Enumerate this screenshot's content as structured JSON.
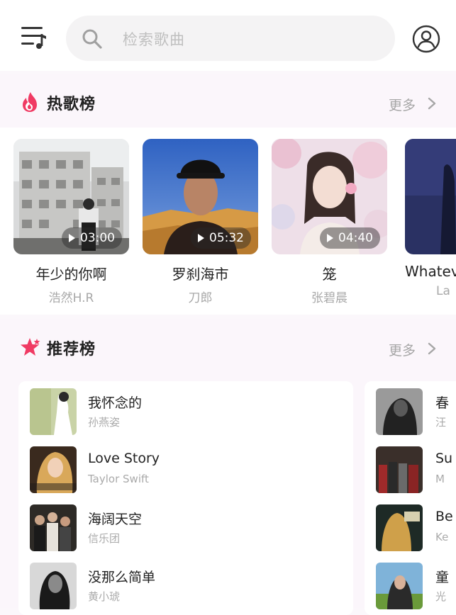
{
  "header": {
    "search_placeholder": "检索歌曲",
    "icons": {
      "menu": "playlist-music-icon",
      "search": "search-icon",
      "user": "user-account-icon"
    }
  },
  "hot": {
    "title": "热歌榜",
    "more_label": "更多",
    "icon": "flame-icon",
    "accent": "#f03a63",
    "items": [
      {
        "title": "年少的你啊",
        "artist": "浩然H.R",
        "duration": "03:00"
      },
      {
        "title": "罗刹海市",
        "artist": "刀郎",
        "duration": "05:32"
      },
      {
        "title": "笼",
        "artist": "张碧晨",
        "duration": "04:40"
      },
      {
        "title": "Whatev",
        "artist": "La",
        "duration": ""
      }
    ]
  },
  "recommend": {
    "title": "推荐榜",
    "more_label": "更多",
    "icon": "star-icon",
    "accent": "#f03a63",
    "items": [
      {
        "title": "我怀念的",
        "artist": "孙燕姿"
      },
      {
        "title": "Love Story",
        "artist": "Taylor Swift"
      },
      {
        "title": "海阔天空",
        "artist": "信乐团"
      },
      {
        "title": "没那么简单",
        "artist": "黄小琥"
      }
    ],
    "items_col2": [
      {
        "title": "春",
        "artist": "汪"
      },
      {
        "title": "Su",
        "artist": "M"
      },
      {
        "title": "Be",
        "artist": "Ke"
      },
      {
        "title": "童",
        "artist": "光"
      }
    ]
  }
}
